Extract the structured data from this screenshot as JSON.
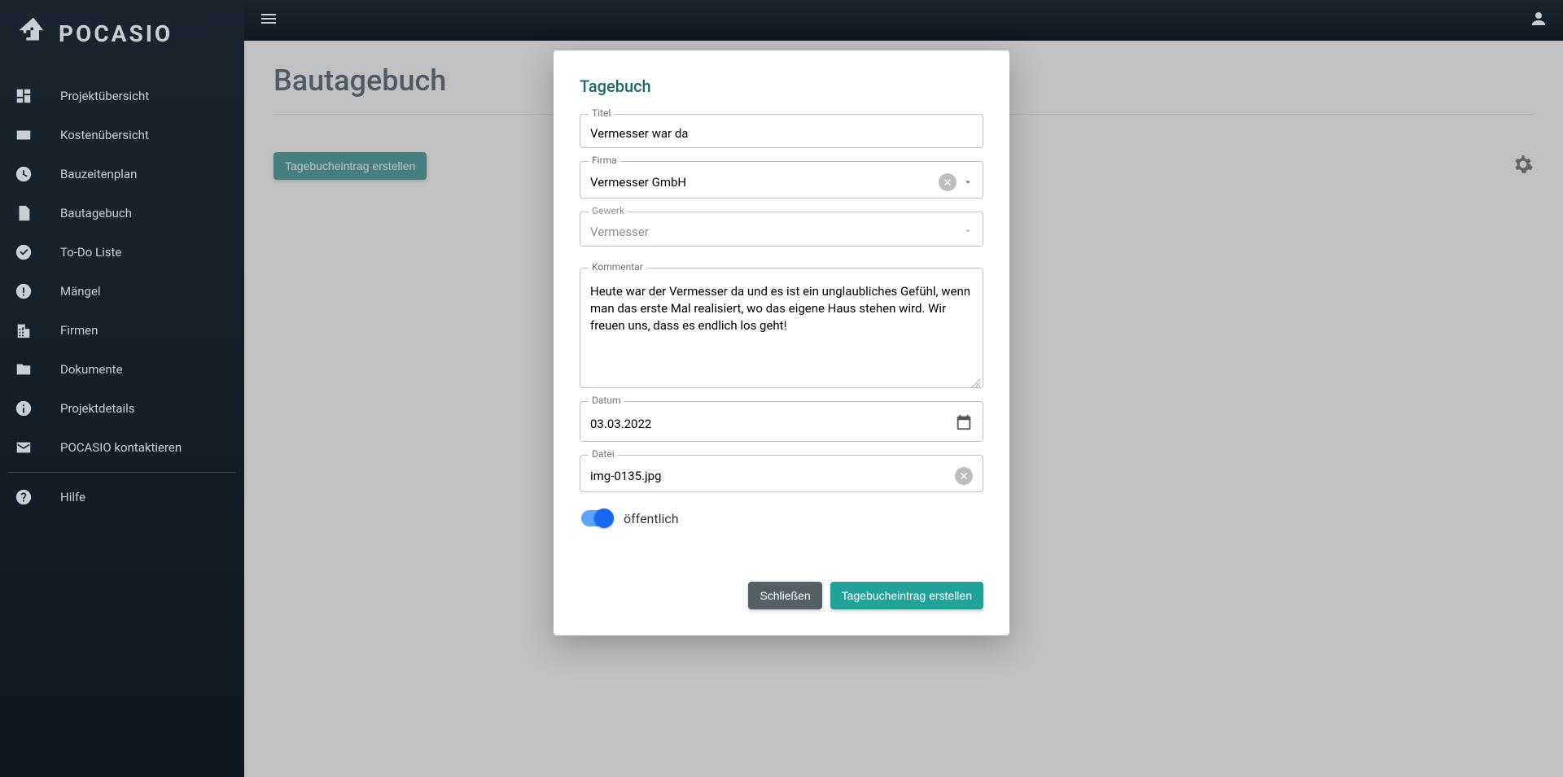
{
  "brand": {
    "name": "POCASIO"
  },
  "sidebar": {
    "items": [
      {
        "label": "Projektübersicht"
      },
      {
        "label": "Kostenübersicht"
      },
      {
        "label": "Bauzeitenplan"
      },
      {
        "label": "Bautagebuch"
      },
      {
        "label": "To-Do Liste"
      },
      {
        "label": "Mängel"
      },
      {
        "label": "Firmen"
      },
      {
        "label": "Dokumente"
      },
      {
        "label": "Projektdetails"
      },
      {
        "label": "POCASIO kontaktieren"
      }
    ],
    "help_label": "Hilfe"
  },
  "page": {
    "title": "Bautagebuch",
    "create_button": "Tagebucheintrag erstellen"
  },
  "modal": {
    "title": "Tagebuch",
    "fields": {
      "titel_label": "Titel",
      "titel_value": "Vermesser war da",
      "firma_label": "Firma",
      "firma_value": "Vermesser GmbH",
      "gewerk_label": "Gewerk",
      "gewerk_value": "Vermesser",
      "kommentar_label": "Kommentar",
      "kommentar_value": "Heute war der Vermesser da und es ist ein unglaubliches Gefühl, wenn man das erste Mal realisiert, wo das eigene Haus stehen wird. Wir freuen uns, dass es endlich los geht!",
      "datum_label": "Datum",
      "datum_value": "03.03.2022",
      "datei_label": "Datei",
      "datei_value": "img-0135.jpg"
    },
    "public_label": "öffentlich",
    "public_value": true,
    "buttons": {
      "close": "Schließen",
      "submit": "Tagebucheintrag erstellen"
    }
  }
}
